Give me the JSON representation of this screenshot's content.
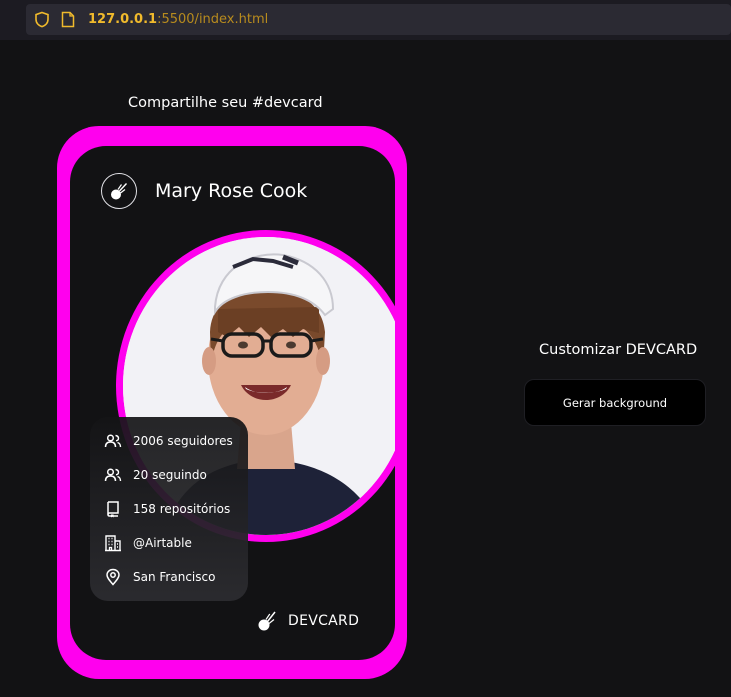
{
  "browser": {
    "url_host": "127.0.0.1",
    "url_rest": ":5500/index.html",
    "icons": [
      "shield-icon",
      "page-icon"
    ]
  },
  "share_title": "Compartilhe seu #devcard",
  "card": {
    "border_color": "#ff00ee",
    "background_color": "#121214",
    "user_name": "Mary Rose Cook",
    "stats": [
      {
        "icon": "followers-icon",
        "text": "2006 seguidores"
      },
      {
        "icon": "following-icon",
        "text": "20 seguindo"
      },
      {
        "icon": "repo-icon",
        "text": "158 repositórios"
      },
      {
        "icon": "company-icon",
        "text": "@Airtable"
      },
      {
        "icon": "location-icon",
        "text": "San Francisco"
      }
    ],
    "footer_label": "DEVCARD"
  },
  "customize": {
    "title": "Customizar DEVCARD",
    "button_label": "Gerar background"
  }
}
